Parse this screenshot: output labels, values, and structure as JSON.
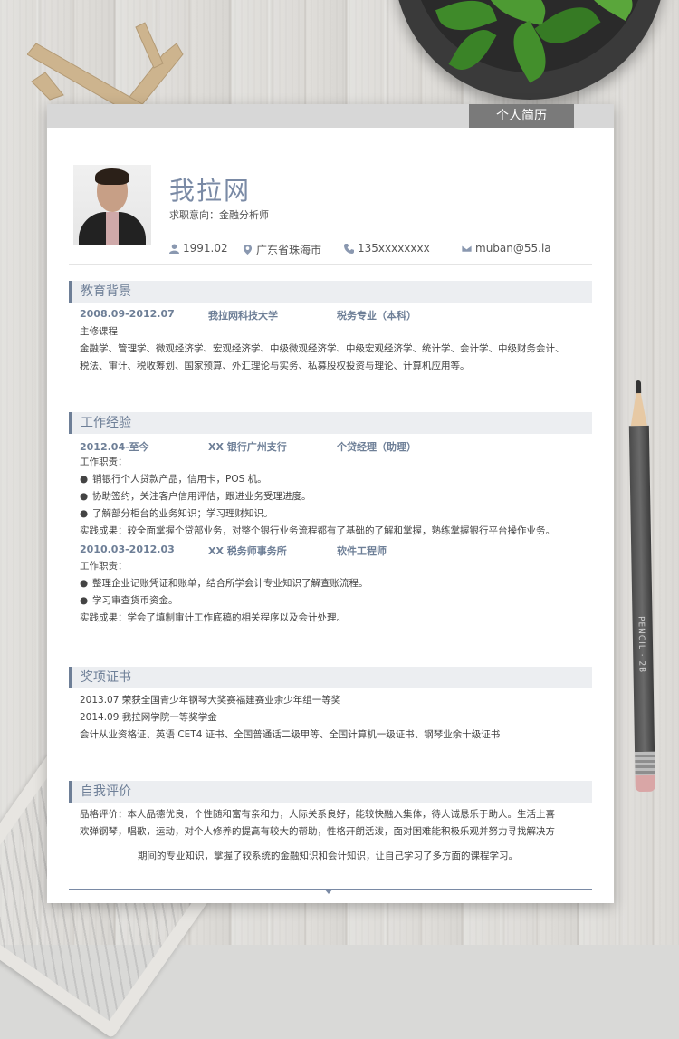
{
  "header": {
    "doc_label": "个人简历",
    "name": "我拉网",
    "intent": "求职意向：金融分析师",
    "birth": "1991.02",
    "location": "广东省珠海市",
    "phone": "135xxxxxxxx",
    "email": "muban@55.la"
  },
  "education": {
    "title": "教育背景",
    "period": "2008.09-2012.07",
    "school": "我拉网科技大学",
    "major": "税务专业（本科）",
    "course_label": "主修课程",
    "courses_line1": "金融学、管理学、微观经济学、宏观经济学、中级微观经济学、中级宏观经济学、统计学、会计学、中级财务会计、",
    "courses_line2": "税法、审计、税收筹划、国家预算、外汇理论与实务、私募股权投资与理论、计算机应用等。"
  },
  "work": {
    "title": "工作经验",
    "jobs": [
      {
        "period": "2012.04-至今",
        "company": "XX 银行广州支行",
        "role": "个贷经理（助理）",
        "duty_label": "工作职责：",
        "duties": [
          "销银行个人贷款产品，信用卡，POS 机。",
          "协助签约，关注客户信用评估，跟进业务受理进度。",
          "了解部分柜台的业务知识；学习理财知识。"
        ],
        "result": "实践成果：较全面掌握个贷部业务，对整个银行业务流程都有了基础的了解和掌握，熟练掌握银行平台操作业务。"
      },
      {
        "period": "2010.03-2012.03",
        "company": "XX 税务师事务所",
        "role": "软件工程师",
        "duty_label": "工作职责：",
        "duties": [
          "整理企业记账凭证和账单，结合所学会计专业知识了解查账流程。",
          "学习审查货币资金。"
        ],
        "result": "实践成果：学会了填制审计工作底稿的相关程序以及会计处理。"
      }
    ]
  },
  "awards": {
    "title": "奖项证书",
    "items": [
      "2013.07  荣获全国青少年钢琴大奖赛福建赛业余少年组一等奖",
      "2014.09  我拉网学院一等奖学金",
      "会计从业资格证、英语 CET4 证书、全国普通话二级甲等、全国计算机一级证书、钢琴业余十级证书"
    ]
  },
  "self_eval": {
    "title": "自我评价",
    "line1": "品格评价：本人品德优良，个性随和富有亲和力，人际关系良好，能较快融入集体，待人诚恳乐于助人。生活上喜",
    "line2": "欢弹钢琴，唱歌，运动，对个人修养的提高有较大的帮助，性格开朗活泼，面对困难能积极乐观并努力寻找解决方",
    "line3": "期间的专业知识，掌握了较系统的金融知识和会计知识，让自己学习了多方面的课程学习。"
  },
  "decor": {
    "pencil_brand": "PENCIL · 2B"
  }
}
